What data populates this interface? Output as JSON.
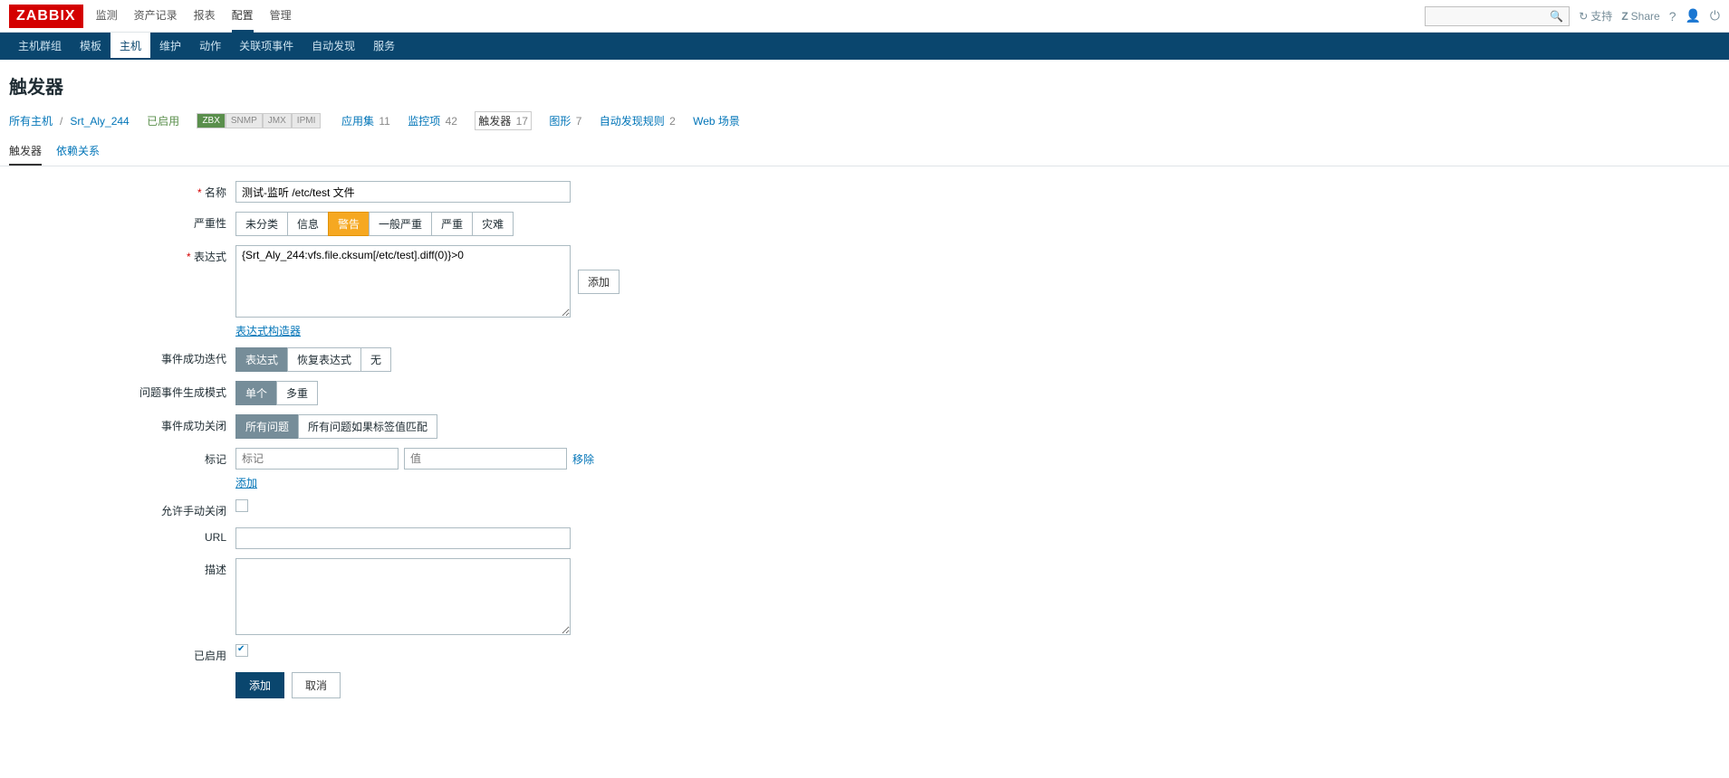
{
  "brand": "ZABBIX",
  "top_menu": [
    "监测",
    "资产记录",
    "报表",
    "配置",
    "管理"
  ],
  "top_menu_active": 3,
  "top_right": {
    "support": "支持",
    "share": "Share"
  },
  "sub_menu": [
    "主机群组",
    "模板",
    "主机",
    "维护",
    "动作",
    "关联项事件",
    "自动发现",
    "服务"
  ],
  "sub_menu_active": 2,
  "page_title": "触发器",
  "crumbs": {
    "all_hosts": "所有主机",
    "host": "Srt_Aly_244",
    "enabled": "已启用",
    "badges": {
      "zbx": "ZBX",
      "snmp": "SNMP",
      "jmx": "JMX",
      "ipmi": "IPMI"
    },
    "items": [
      {
        "label": "应用集",
        "count": "11",
        "current": false
      },
      {
        "label": "监控项",
        "count": "42",
        "current": false
      },
      {
        "label": "触发器",
        "count": "17",
        "current": true
      },
      {
        "label": "图形",
        "count": "7",
        "current": false
      },
      {
        "label": "自动发现规则",
        "count": "2",
        "current": false
      },
      {
        "label": "Web 场景",
        "count": "",
        "current": false
      }
    ]
  },
  "tabs": {
    "trigger": "触发器",
    "deps": "依赖关系",
    "active": 0
  },
  "form": {
    "name": {
      "label": "名称",
      "value": "测试-监听 /etc/test 文件"
    },
    "severity": {
      "label": "严重性",
      "options": [
        "未分类",
        "信息",
        "警告",
        "一般严重",
        "严重",
        "灾难"
      ],
      "selected": 2
    },
    "expression": {
      "label": "表达式",
      "value": "{Srt_Aly_244:vfs.file.cksum[/etc/test].diff(0)}>0",
      "add_btn": "添加",
      "builder": "表达式构造器"
    },
    "ok_event": {
      "label": "事件成功迭代",
      "options": [
        "表达式",
        "恢复表达式",
        "无"
      ],
      "selected": 0
    },
    "problem_mode": {
      "label": "问题事件生成模式",
      "options": [
        "单个",
        "多重"
      ],
      "selected": 0
    },
    "ok_close": {
      "label": "事件成功关闭",
      "options": [
        "所有问题",
        "所有问题如果标签值匹配"
      ],
      "selected": 0
    },
    "tags": {
      "label": "标记",
      "tag_ph": "标记",
      "val_ph": "值",
      "remove": "移除",
      "add": "添加"
    },
    "manual_close": {
      "label": "允许手动关闭",
      "checked": false
    },
    "url": {
      "label": "URL",
      "value": ""
    },
    "desc": {
      "label": "描述",
      "value": ""
    },
    "enabled": {
      "label": "已启用",
      "checked": true
    },
    "buttons": {
      "add": "添加",
      "cancel": "取消"
    }
  }
}
